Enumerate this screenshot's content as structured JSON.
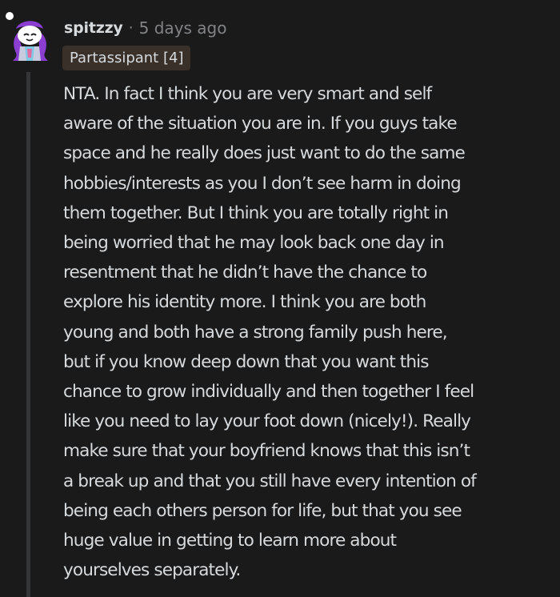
{
  "comment": {
    "avatar_icon": "snoo-avatar-icon",
    "username": "spitzzy",
    "separator": "·",
    "timestamp": "5 days ago",
    "flair": "Partassipant [4]",
    "body_lines": [
      "NTA. In fact I think you are very smart and self",
      "aware of the situation you are in. If you guys take",
      "space and he really does just want to do the same",
      "hobbies/interests as you I don’t see harm in doing",
      "them together. But I think you are totally right in",
      "being worried that he may look back one day in",
      "resentment that he didn’t have the chance to",
      "explore his identity more. I think you are both",
      "young and both have a strong family push here,",
      "but if you know deep down that you want this",
      "chance to grow individually and then together I feel",
      "like you need to lay your foot down (nicely!). Really",
      "make sure that your boyfriend knows that this isn’t",
      "a break up and that you still have every intention of",
      "being each others person for life, but that you see",
      "huge value in getting to learn more about",
      "yourselves separately."
    ]
  },
  "colors": {
    "background": "#1a1a1b",
    "text": "#d7dadc",
    "muted_text": "#818384",
    "flair_background": "#39302a",
    "thread_line": "#343536",
    "avatar_purple": "#8a3fd0"
  }
}
